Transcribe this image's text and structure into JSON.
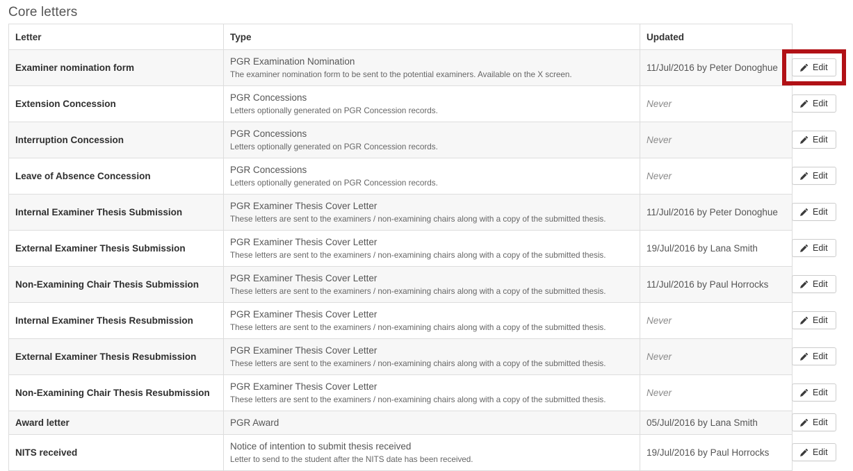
{
  "page": {
    "title": "Core letters"
  },
  "table": {
    "columns": [
      {
        "key": "letter",
        "label": "Letter"
      },
      {
        "key": "type",
        "label": "Type"
      },
      {
        "key": "updated",
        "label": "Updated"
      },
      {
        "key": "action",
        "label": ""
      }
    ],
    "edit_button_label": "Edit",
    "edit_button_icon": "pencil-icon",
    "never_label": "Never",
    "rows": [
      {
        "letter": "Examiner nomination form",
        "type_title": "PGR Examination Nomination",
        "type_desc": "The examiner nomination form to be sent to the potential examiners. Available on the X screen.",
        "updated": "11/Jul/2016 by Peter Donoghue",
        "never": false,
        "highlighted": true
      },
      {
        "letter": "Extension Concession",
        "type_title": "PGR Concessions",
        "type_desc": "Letters optionally generated on PGR Concession records.",
        "updated": "Never",
        "never": true,
        "highlighted": false
      },
      {
        "letter": "Interruption Concession",
        "type_title": "PGR Concessions",
        "type_desc": "Letters optionally generated on PGR Concession records.",
        "updated": "Never",
        "never": true,
        "highlighted": false
      },
      {
        "letter": "Leave of Absence Concession",
        "type_title": "PGR Concessions",
        "type_desc": "Letters optionally generated on PGR Concession records.",
        "updated": "Never",
        "never": true,
        "highlighted": false
      },
      {
        "letter": "Internal Examiner Thesis Submission",
        "type_title": "PGR Examiner Thesis Cover Letter",
        "type_desc": "These letters are sent to the examiners / non-examining chairs along with a copy of the submitted thesis.",
        "updated": "11/Jul/2016 by Peter Donoghue",
        "never": false,
        "highlighted": false
      },
      {
        "letter": "External Examiner Thesis Submission",
        "type_title": "PGR Examiner Thesis Cover Letter",
        "type_desc": "These letters are sent to the examiners / non-examining chairs along with a copy of the submitted thesis.",
        "updated": "19/Jul/2016 by Lana Smith",
        "never": false,
        "highlighted": false
      },
      {
        "letter": "Non-Examining Chair Thesis Submission",
        "type_title": "PGR Examiner Thesis Cover Letter",
        "type_desc": "These letters are sent to the examiners / non-examining chairs along with a copy of the submitted thesis.",
        "updated": "11/Jul/2016 by Paul Horrocks",
        "never": false,
        "highlighted": false
      },
      {
        "letter": "Internal Examiner Thesis Resubmission",
        "type_title": "PGR Examiner Thesis Cover Letter",
        "type_desc": "These letters are sent to the examiners / non-examining chairs along with a copy of the submitted thesis.",
        "updated": "Never",
        "never": true,
        "highlighted": false
      },
      {
        "letter": "External Examiner Thesis Resubmission",
        "type_title": "PGR Examiner Thesis Cover Letter",
        "type_desc": "These letters are sent to the examiners / non-examining chairs along with a copy of the submitted thesis.",
        "updated": "Never",
        "never": true,
        "highlighted": false
      },
      {
        "letter": "Non-Examining Chair Thesis Resubmission",
        "type_title": "PGR Examiner Thesis Cover Letter",
        "type_desc": "These letters are sent to the examiners / non-examining chairs along with a copy of the submitted thesis.",
        "updated": "Never",
        "never": true,
        "highlighted": false
      },
      {
        "letter": "Award letter",
        "type_title": "PGR Award",
        "type_desc": "",
        "updated": "05/Jul/2016 by Lana Smith",
        "never": false,
        "highlighted": false
      },
      {
        "letter": "NITS received",
        "type_title": "Notice of intention to submit thesis received",
        "type_desc": "Letter to send to the student after the NITS date has been received.",
        "updated": "19/Jul/2016 by Paul Horrocks",
        "never": false,
        "highlighted": false
      }
    ]
  },
  "colors": {
    "highlight": "#b11116",
    "table_border": "#dddddd",
    "row_stripe": "#f7f7f7",
    "title_text": "#555555"
  }
}
